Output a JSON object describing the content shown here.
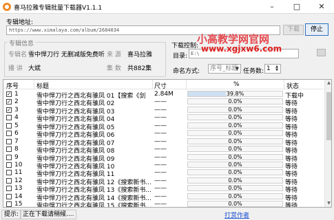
{
  "window": {
    "title": "喜马拉雅专辑批量下载器V1.1.1",
    "minimize": "–",
    "maximize": "□",
    "close": "✕"
  },
  "url_section": {
    "label": "专辑地址:",
    "value": "https://www.ximalaya.com/album/2684034",
    "download_button": "下载",
    "stop_button": "停止"
  },
  "watermark": {
    "line1": "小高教学网官网",
    "line2": "www.xgjxw6.com"
  },
  "album_info": {
    "group_title": "专辑信息",
    "name_label": "专辑名",
    "name_value": "雪中悍刀行 无删减版免费听",
    "source_label": "来  源",
    "source_value": "喜马拉雅",
    "reader_label": "播  讲",
    "reader_value": "大斌",
    "episodes_label": "集  数",
    "episodes_value": "共882集"
  },
  "download_control": {
    "group_title": "下载控制:",
    "dir_label": "目录:",
    "dir_value": "E:\\",
    "naming_label": "命名方式:",
    "naming_value": "序号_标题",
    "tasks_label": "任务数:",
    "tasks_value": "1"
  },
  "table": {
    "columns": [
      "序号",
      "标题",
      "尺寸",
      "%",
      "状态"
    ],
    "rows": [
      {
        "checked": true,
        "num": "1",
        "title": "雪中悍刀行之西北有骓凤 01【搜索《剑",
        "size": "2.84M",
        "progress": 39.8,
        "progress_text": "39.8%",
        "status": "下载中"
      },
      {
        "checked": true,
        "num": "2",
        "title": "雪中悍刀行之西北有骓凤 02",
        "size": "——",
        "progress": 0,
        "progress_text": "0.0%",
        "status": "等待"
      },
      {
        "checked": true,
        "num": "3",
        "title": "雪中悍刀行之西北有骓凤 03",
        "size": "——",
        "progress": 0,
        "progress_text": "0.0%",
        "status": "等待"
      },
      {
        "checked": false,
        "num": "4",
        "title": "雪中悍刀行之西北有骓凤 04",
        "size": "——",
        "progress": 0,
        "progress_text": "0.0%",
        "status": "等待"
      },
      {
        "checked": false,
        "num": "5",
        "title": "雪中悍刀行之西北有骓凤 05",
        "size": "——",
        "progress": 0,
        "progress_text": "0.0%",
        "status": "等待"
      },
      {
        "checked": false,
        "num": "6",
        "title": "雪中悍刀行之西北有骓凤 06",
        "size": "——",
        "progress": 0,
        "progress_text": "0.0%",
        "status": "等待"
      },
      {
        "checked": false,
        "num": "7",
        "title": "雪中悍刀行之西北有骓凤 07",
        "size": "——",
        "progress": 0,
        "progress_text": "0.0%",
        "status": "等待"
      },
      {
        "checked": false,
        "num": "8",
        "title": "雪中悍刀行之西北有骓凤 08",
        "size": "——",
        "progress": 0,
        "progress_text": "0.0%",
        "status": "等待"
      },
      {
        "checked": false,
        "num": "9",
        "title": "雪中悍刀行之西北有骓凤 09",
        "size": "——",
        "progress": 0,
        "progress_text": "0.0%",
        "status": "等待"
      },
      {
        "checked": false,
        "num": "10",
        "title": "雪中悍刀行之西北有骓凤 10",
        "size": "——",
        "progress": 0,
        "progress_text": "0.0%",
        "status": "等待"
      },
      {
        "checked": false,
        "num": "11",
        "title": "雪中悍刀行之西北有骓凤 11",
        "size": "——",
        "progress": 0,
        "progress_text": "0.0%",
        "status": "等待"
      },
      {
        "checked": false,
        "num": "12",
        "title": "雪中悍刀行之西北有骓凤 12《搜索新书...",
        "size": "——",
        "progress": 0,
        "progress_text": "0.0%",
        "status": "等待"
      },
      {
        "checked": false,
        "num": "13",
        "title": "雪中悍刀行之西北有骓凤 13《搜索新书...",
        "size": "——",
        "progress": 0,
        "progress_text": "0.0%",
        "status": "等待"
      },
      {
        "checked": false,
        "num": "14",
        "title": "雪中悍刀行之西北有骓凤 14《搜索新书...",
        "size": "——",
        "progress": 0,
        "progress_text": "0.0%",
        "status": "等待"
      },
      {
        "checked": false,
        "num": "15",
        "title": "雪中悍刀行之西北有骓凤 15《搜索新书...",
        "size": "——",
        "progress": 0,
        "progress_text": "0.0%",
        "status": "等待"
      }
    ]
  },
  "statusbar": {
    "hint_label": "提示:",
    "message": "正在下载请稍候....",
    "report_link": "打赏作者"
  },
  "colors": {
    "progress_fill": "#cddff0",
    "watermark": "#e5484d",
    "link": "#1a4fd0",
    "stop_border": "#2c6fbf"
  }
}
